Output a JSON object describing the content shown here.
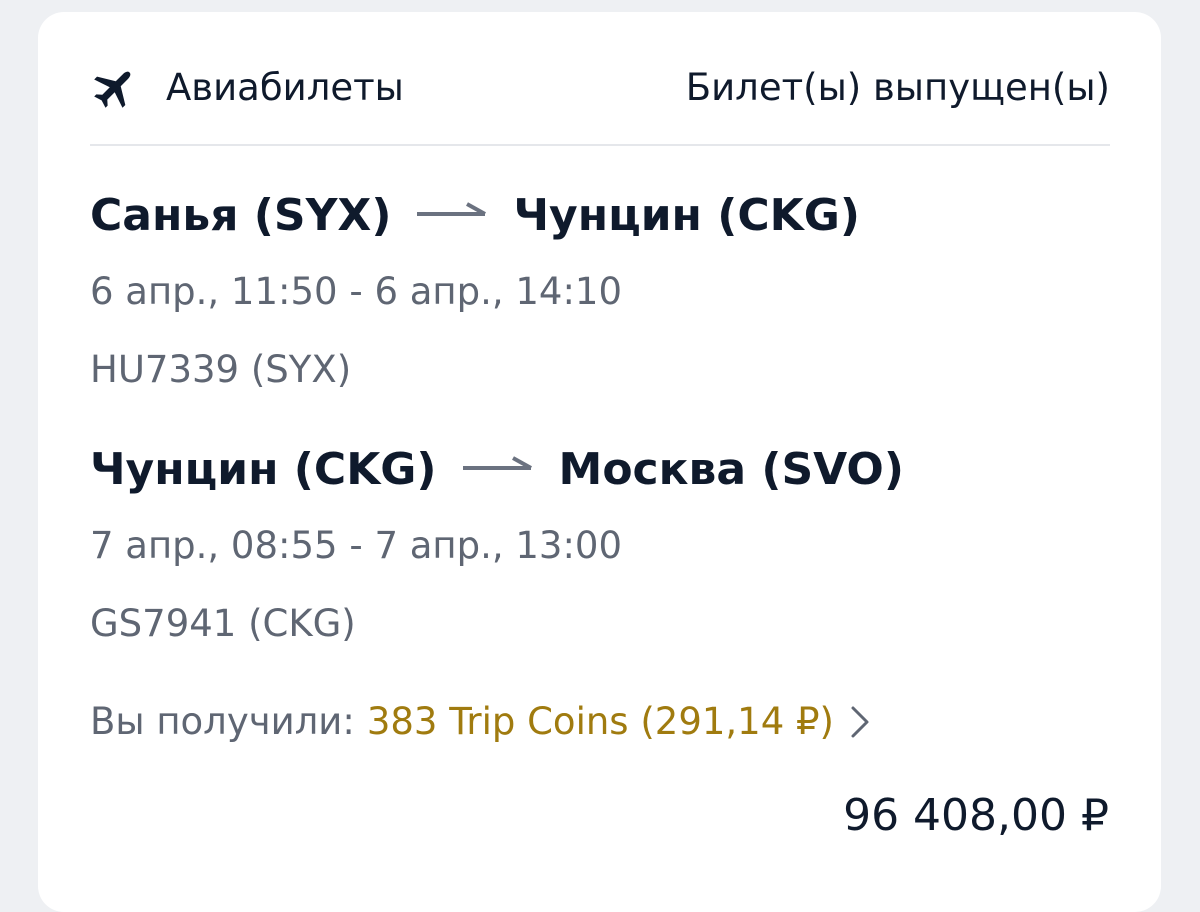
{
  "header": {
    "category": "Авиабилеты",
    "status": "Билет(ы) выпущен(ы)",
    "icon": "airplane-icon"
  },
  "segments": [
    {
      "from": "Санья (SYX)",
      "to": "Чунцин (CKG)",
      "times": "6 апр., 11:50 - 6 апр., 14:10",
      "flight": "HU7339 (SYX)"
    },
    {
      "from": "Чунцин (CKG)",
      "to": "Москва (SVO)",
      "times": "7 апр., 08:55 - 7 апр., 13:00",
      "flight": "GS7941 (CKG)"
    }
  ],
  "rewards": {
    "label": "Вы получили:",
    "value": "383 Trip Coins (291,14 ₽)"
  },
  "price": "96 408,00 ₽",
  "colors": {
    "text_primary": "#0f1a2c",
    "text_secondary": "#5f6673",
    "coins_accent": "#a07b0f",
    "arrow": "#6b7280",
    "background": "#eef0f3",
    "card": "#ffffff"
  }
}
